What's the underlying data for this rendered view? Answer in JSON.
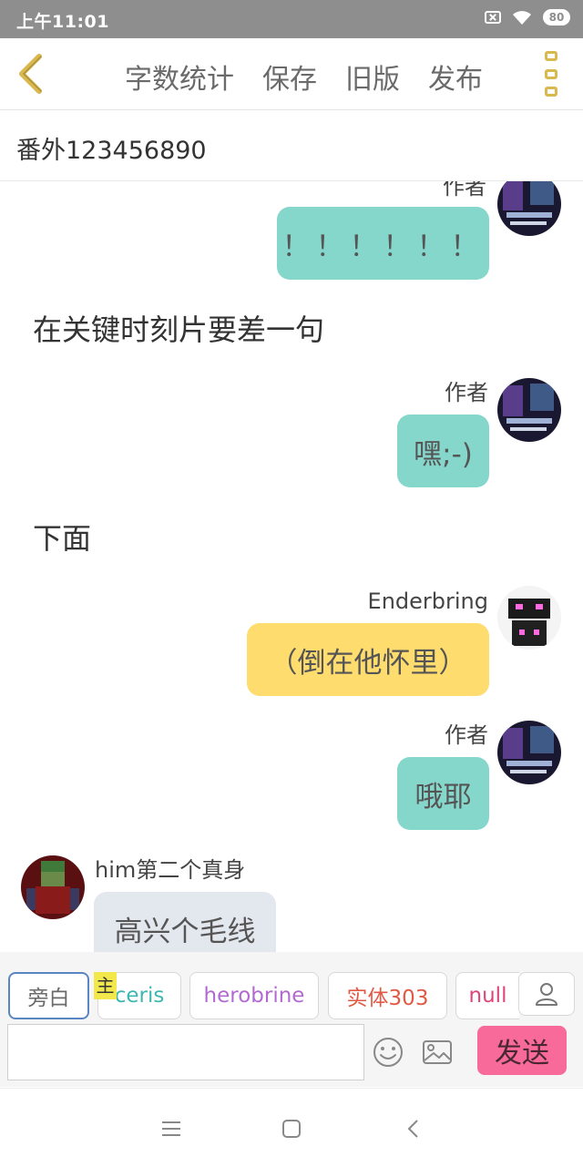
{
  "status_bar": {
    "time": "上午11:01",
    "battery": "80"
  },
  "toolbar": {
    "back_icon": "chevron-left-icon",
    "items": [
      "字数统计",
      "保存",
      "旧版",
      "发布"
    ],
    "more_icon": "vertical-dots-icon",
    "accent": "#d9b84d"
  },
  "document": {
    "title": "番外123456890"
  },
  "messages": [
    {
      "speaker": "作者",
      "text": "！！！！！！",
      "side": "right",
      "color": "#86d7cb"
    },
    {
      "kind": "narration",
      "text": "在关键时刻片要差一句"
    },
    {
      "speaker": "作者",
      "text": "嘿;-)",
      "side": "right",
      "color": "#86d7cb"
    },
    {
      "kind": "narration",
      "text": "下面"
    },
    {
      "speaker": "Enderbring",
      "text": "（倒在他怀里）",
      "side": "right",
      "color": "#fedc6e"
    },
    {
      "speaker": "作者",
      "text": "哦耶",
      "side": "right",
      "color": "#86d7cb"
    },
    {
      "speaker": "him第二个真身",
      "text": "高兴个毛线",
      "side": "left",
      "color": "#e3e7ee"
    }
  ],
  "characters": {
    "chips": [
      {
        "label": "旁白",
        "color": "#6a6a6a",
        "selected": true
      },
      {
        "label": "ceris",
        "color": "#3bb8b0",
        "tag": "主"
      },
      {
        "label": "herobrine",
        "color": "#b26ad0"
      },
      {
        "label": "实体303",
        "color": "#e05a45"
      },
      {
        "label": "null",
        "color": "#e0457a"
      }
    ],
    "user_icon": "person-icon"
  },
  "composer": {
    "input_value": "",
    "emoji_icon": "smiley-icon",
    "image_icon": "image-icon",
    "send_label": "发送",
    "send_color": "#f76a9a"
  },
  "nav": {
    "menu_icon": "menu-icon",
    "home_icon": "square-icon",
    "back_icon": "back-triangle-icon"
  }
}
